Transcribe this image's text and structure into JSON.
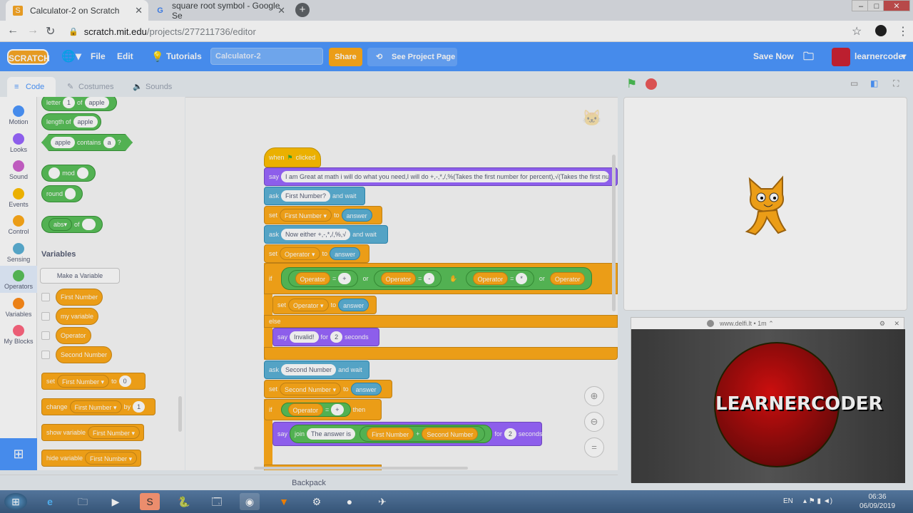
{
  "browser": {
    "tabs": [
      {
        "title": "Calculator-2 on Scratch",
        "favicon": "scratch-favicon"
      },
      {
        "title": "square root symbol - Google Se",
        "favicon": "google-favicon"
      }
    ],
    "url_host": "scratch.mit.edu",
    "url_path": "/projects/277211736/editor"
  },
  "menubar": {
    "logo": "SCRATCH",
    "file": "File",
    "edit": "Edit",
    "tutorials": "Tutorials",
    "project_title": "Calculator-2",
    "share": "Share",
    "see_project": "See Project Page",
    "save_now": "Save Now",
    "username": "learnercoder"
  },
  "editor_tabs": {
    "code": "Code",
    "costumes": "Costumes",
    "sounds": "Sounds"
  },
  "categories": [
    {
      "label": "Motion",
      "color": "#4c97ff"
    },
    {
      "label": "Looks",
      "color": "#9966ff"
    },
    {
      "label": "Sound",
      "color": "#cf63cf"
    },
    {
      "label": "Events",
      "color": "#ffbf00"
    },
    {
      "label": "Control",
      "color": "#ffab19"
    },
    {
      "label": "Sensing",
      "color": "#5cb1d6"
    },
    {
      "label": "Operators",
      "color": "#59c059"
    },
    {
      "label": "Variables",
      "color": "#ff8c1a"
    },
    {
      "label": "My Blocks",
      "color": "#ff6680"
    }
  ],
  "palette": {
    "letter": "letter",
    "letter_num": "1",
    "of": "of",
    "apple": "apple",
    "length_of": "length of",
    "contains": "contains",
    "a": "a",
    "q": "?",
    "mod": "mod",
    "round": "round",
    "abs": "abs",
    "variables_header": "Variables",
    "make_variable": "Make a Variable",
    "variables": [
      "First Number",
      "my variable",
      "Operator",
      "Second Number"
    ],
    "set": "set",
    "to": "to",
    "zero": "0",
    "change": "change",
    "by": "by",
    "one": "1",
    "show_variable": "show variable",
    "hide_variable": "hide variable",
    "first_number": "First Number"
  },
  "script": {
    "when": "when",
    "clicked": "clicked",
    "say": "say",
    "say_text": "I am Great at math i will do what you need,I will do +,-,*,/,%(Takes the first number for percent),√(Takes the first num",
    "ask": "ask",
    "and_wait": "and wait",
    "q1": "First Number?",
    "set": "set",
    "to": "to",
    "answer": "answer",
    "first_number": "First Number",
    "q2": "Now either +,-,*,/,%,√",
    "operator": "Operator",
    "if": "if",
    "eq": "=",
    "or": "or",
    "plus": "+",
    "minus": "-",
    "times": "*",
    "else": "else",
    "invalid": "Invalid!",
    "for": "for",
    "two": "2",
    "seconds": "seconds",
    "q3": "Second Number",
    "second_number": "Second Number",
    "then": "then",
    "join": "join",
    "answer_is": "The answer is"
  },
  "backpack": "Backpack",
  "popup": {
    "source": "www.delfi.lt",
    "age": "1m",
    "logo_text": "LEARNERCODER"
  },
  "taskbar": {
    "lang": "EN",
    "time": "06:36",
    "date": "06/09/2019"
  }
}
